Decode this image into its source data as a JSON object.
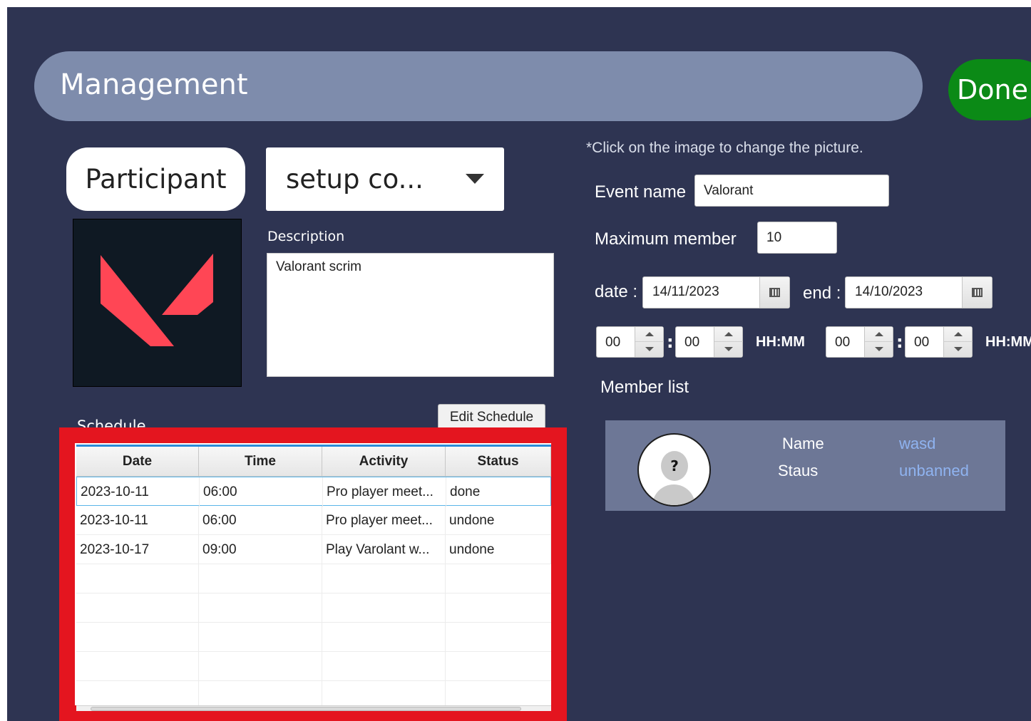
{
  "header": {
    "title": "Management",
    "done_label": "Done"
  },
  "left": {
    "participant_label": "Participant",
    "dropdown_value": "setup co...",
    "description_label": "Description",
    "description_value": "Valorant scrim",
    "schedule_label": "Schedule",
    "edit_schedule_label": "Edit Schedule"
  },
  "schedule_table": {
    "columns": [
      "Date",
      "Time",
      "Activity",
      "Status"
    ],
    "rows": [
      [
        "2023-10-11",
        "06:00",
        "Pro player meet...",
        "done"
      ],
      [
        "2023-10-11",
        "06:00",
        "Pro player meet...",
        "undone"
      ],
      [
        "2023-10-17",
        "09:00",
        "Play Varolant w...",
        "undone"
      ]
    ]
  },
  "right": {
    "hint": "*Click on the image to change the picture.",
    "event_name_label": "Event name",
    "event_name_value": "Valorant",
    "max_member_label": "Maximum  member",
    "max_member_value": "10",
    "date_label": "date :",
    "date_value": "14/11/2023",
    "end_label": "end :",
    "end_value": "14/10/2023",
    "start_hour": "00",
    "start_minute": "00",
    "end_hour": "00",
    "end_minute": "00",
    "colon": ":",
    "time_format_label": "HH:MM",
    "member_list_label": "Member list"
  },
  "member": {
    "name_label": "Name",
    "name_value": "wasd",
    "status_label": "Staus",
    "status_value": "unbanned",
    "avatar_symbol": "?"
  },
  "colors": {
    "background": "#2e3452",
    "header": "#7e8cac",
    "done": "#0b8a16",
    "highlight": "#e4151f",
    "valorant_red": "#ff4655"
  }
}
